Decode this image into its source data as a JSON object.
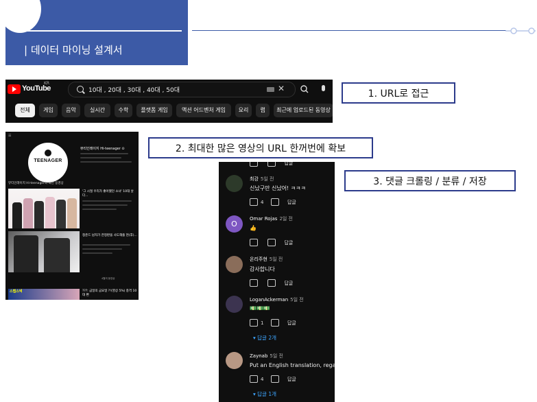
{
  "header": {
    "title": "| 데이터 마이닝 설계서"
  },
  "youtube_bar": {
    "logo": "YouTube",
    "region": "KR",
    "search_value": "10대 , 20대 , 30대 , 40대 , 50대",
    "chips": [
      "전체",
      "게임",
      "음악",
      "실시간",
      "수학",
      "플랫폼 게임",
      "액션 어드벤처 게임",
      "요리",
      "랩",
      "최근에 업로드된 동영상"
    ]
  },
  "labels": {
    "step1": "1. URL로 접근",
    "step2": "2. 최대한 많은 영상의 URL 한꺼번에 확보",
    "step3": "3. 댓글 크롤링 / 분류 / 저장"
  },
  "channel": {
    "logo_text": "TEENAGER",
    "name": "뷰티인래이지 Hi-teenager ⊙",
    "section": "뷰티인래이지 Hi-teenager의 최신 동영상",
    "video1_title": "'그 시절 우리가 좋아했던 소녀' 10대 날다...",
    "video2_title": "청춘드 남자가 한정판을 사도해줄 현(후)...",
    "video3_thumb": "스탭스낵",
    "video3_title": "???: 금일의 금요일 ?!(영상 5%) 충격 10대 편",
    "more": "4월의 동영상"
  },
  "comments": [
    {
      "author": "최강",
      "time": "5일 전",
      "text": "신났구만 신났어! ㅋㅋㅋ",
      "likes": "4",
      "reply": "답글",
      "avatar_color": "#2d3a2a"
    },
    {
      "author": "Omar Rojas",
      "time": "2일 전",
      "text": "👍",
      "likes": "",
      "reply": "답글",
      "avatar_color": "#7e57c2",
      "avatar_letter": "O"
    },
    {
      "author": "온리주현",
      "time": "5일 전",
      "text": "감사합니다",
      "likes": "",
      "reply": "답글",
      "avatar_color": "#8a6d5a"
    },
    {
      "author": "LoganAckerman",
      "time": "5일 전",
      "text": "💵💵💵",
      "likes": "1",
      "reply": "답글",
      "avatar_color": "#3c3450",
      "replies": "답글 2개"
    },
    {
      "author": "Zaynab",
      "time": "5일 전",
      "text": "Put an English translation, regar",
      "likes": "4",
      "reply": "답글",
      "avatar_color": "#b89884",
      "replies": "답글 1개"
    }
  ],
  "colors": {
    "accent": "#3c5aa6",
    "label_border": "#2b3a8b",
    "reply_link": "#3ea6ff"
  }
}
